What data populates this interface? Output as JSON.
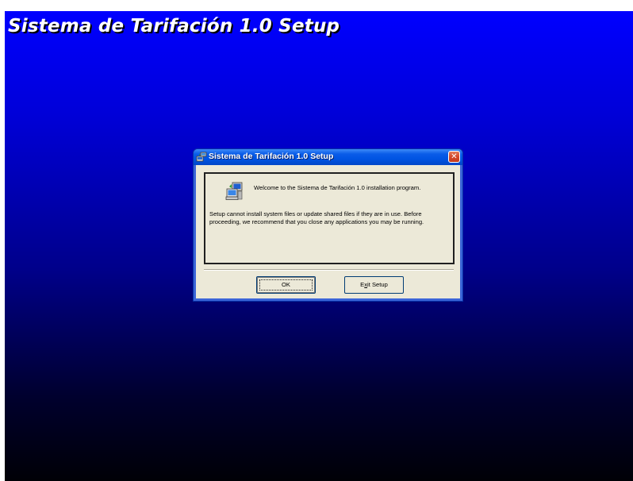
{
  "background": {
    "title": "Sistema de Tarifación 1.0 Setup",
    "gradient_top": "#0000ff",
    "gradient_bottom": "#000006"
  },
  "dialog": {
    "title": "Sistema de Tarifación 1.0 Setup",
    "icons": {
      "app": "setup-icon",
      "message": "computer-install-icon",
      "close": "close-icon"
    },
    "welcome": "Welcome to the Sistema de Tarifación 1.0 installation program.",
    "warning": "Setup cannot install system files or update shared files if they are in use. Before proceeding, we recommend that you close any applications you may be running.",
    "buttons": {
      "ok": "OK",
      "exit_prefix": "E",
      "exit_accel": "x",
      "exit_suffix": "it Setup"
    },
    "colors": {
      "titlebar": "#0054e3",
      "close": "#d6492c",
      "body": "#ece9d8"
    }
  }
}
